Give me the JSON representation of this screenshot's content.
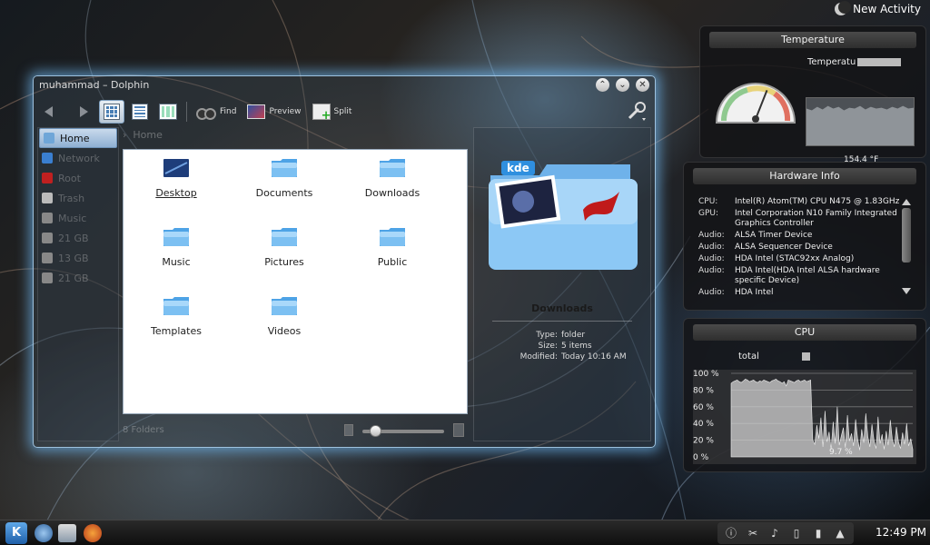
{
  "desktop": {
    "new_activity": "New Activity"
  },
  "temperature_widget": {
    "title": "Temperature",
    "sensor_label": "Temperatu",
    "value": "154.4 °F",
    "gauge_fraction": 0.62
  },
  "hardware_widget": {
    "title": "Hardware Info",
    "rows": [
      {
        "key": "CPU:",
        "value": "Intel(R) Atom(TM) CPU N475 @ 1.83GHz"
      },
      {
        "key": "GPU:",
        "value": "Intel Corporation N10 Family Integrated Graphics Controller"
      },
      {
        "key": "Audio:",
        "value": "ALSA Timer Device"
      },
      {
        "key": "Audio:",
        "value": "ALSA Sequencer Device"
      },
      {
        "key": "Audio:",
        "value": "HDA Intel (STAC92xx Analog)"
      },
      {
        "key": "Audio:",
        "value": "HDA Intel(HDA Intel ALSA hardware specific Device)"
      },
      {
        "key": "Audio:",
        "value": "HDA Intel"
      }
    ]
  },
  "cpu_widget": {
    "title": "CPU",
    "legend": "total",
    "current": "9.7 %",
    "y_ticks": [
      "100 %",
      "80 %",
      "60 %",
      "40 %",
      "20 %",
      "0 %"
    ],
    "series": [
      88,
      90,
      91,
      92,
      90,
      89,
      91,
      93,
      92,
      90,
      91,
      92,
      90,
      89,
      91,
      90,
      92,
      91,
      90,
      89,
      91,
      92,
      93,
      91,
      90,
      88,
      90,
      85,
      92,
      91,
      90,
      89,
      91,
      92,
      90,
      91,
      92,
      90,
      91,
      92,
      20,
      15,
      38,
      22,
      47,
      12,
      55,
      18,
      30,
      9,
      42,
      16,
      60,
      14,
      25,
      35,
      11,
      50,
      19,
      28,
      13,
      45,
      22,
      8,
      33,
      17,
      52,
      24,
      12,
      39,
      20,
      10,
      48,
      16,
      27,
      9,
      31,
      14,
      44,
      21,
      12,
      36,
      18,
      10,
      29,
      15,
      40,
      13,
      22,
      9
    ]
  },
  "dolphin": {
    "title": "muhammad – Dolphin",
    "toolbar": {
      "find": "Find",
      "preview": "Preview",
      "split": "Split"
    },
    "places": [
      {
        "label": "Home",
        "color": "#6fa6d8"
      },
      {
        "label": "Network",
        "color": "#3a7fd0"
      },
      {
        "label": "Root",
        "color": "#c02020"
      },
      {
        "label": "Trash",
        "color": "#bbbbbb"
      },
      {
        "label": "Music",
        "color": "#888888"
      },
      {
        "label": "21 GB",
        "color": "#888888"
      },
      {
        "label": "13 GB",
        "color": "#888888"
      },
      {
        "label": "21 GB",
        "color": "#888888"
      }
    ],
    "breadcrumb": "Home",
    "files": [
      {
        "label": "Desktop"
      },
      {
        "label": "Documents"
      },
      {
        "label": "Downloads"
      },
      {
        "label": "Music"
      },
      {
        "label": "Pictures"
      },
      {
        "label": "Public"
      },
      {
        "label": "Templates"
      },
      {
        "label": "Videos"
      }
    ],
    "status": "8 Folders",
    "zoom_fraction": 0.15,
    "info_panel": {
      "badge": "kde",
      "name": "Downloads",
      "type_key": "Type:",
      "type_val": "folder",
      "size_key": "Size:",
      "size_val": "5 items",
      "modified_key": "Modified:",
      "modified_val": "Today 10:16 AM"
    }
  },
  "taskbar": {
    "clock": "12:49 PM"
  }
}
